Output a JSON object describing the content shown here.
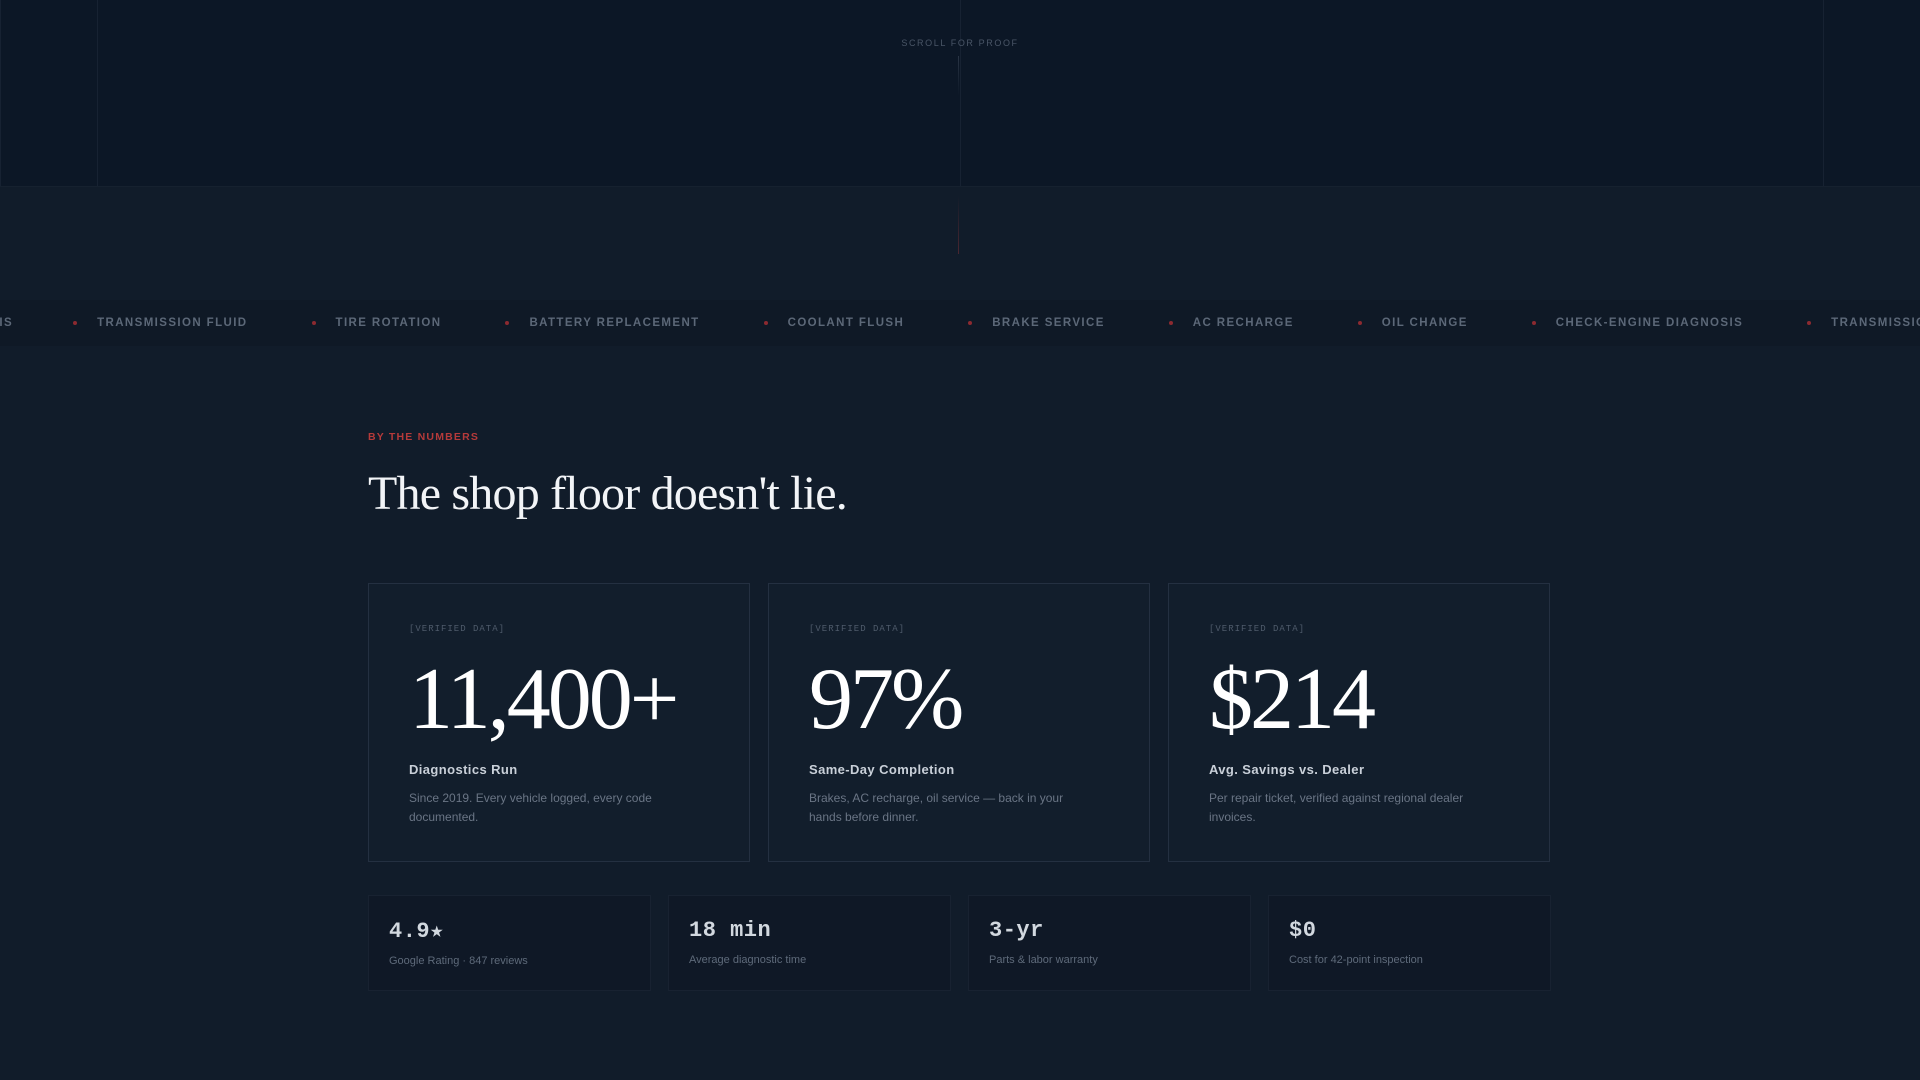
{
  "hero": {
    "scroll_label": "SCROLL FOR PROOF"
  },
  "ticker": {
    "items": [
      "OSIS",
      "TRANSMISSION FLUID",
      "TIRE ROTATION",
      "BATTERY REPLACEMENT",
      "COOLANT FLUSH",
      "BRAKE SERVICE",
      "AC RECHARGE",
      "OIL CHANGE",
      "CHECK-ENGINE DIAGNOSIS",
      "TRANSMISSION FLUID"
    ],
    "dot_color": "#8c2a30"
  },
  "stats": {
    "eyebrow": "BY THE NUMBERS",
    "headline": "The shop floor doesn't lie.",
    "accent_color": "#b63a3a",
    "cards": [
      {
        "tag": "[VERIFIED DATA]",
        "value": "11,400+",
        "title": "Diagnostics Run",
        "desc": "Since 2019. Every vehicle logged, every code documented."
      },
      {
        "tag": "[VERIFIED DATA]",
        "value": "97%",
        "title": "Same-Day Completion",
        "desc": "Brakes, AC recharge, oil service — back in your hands before dinner."
      },
      {
        "tag": "[VERIFIED DATA]",
        "value": "$214",
        "title": "Avg. Savings vs. Dealer",
        "desc": "Per repair ticket, verified against regional dealer invoices."
      }
    ],
    "mini": [
      {
        "value": "4.9★",
        "label": "Google Rating · 847 reviews"
      },
      {
        "value": "18 min",
        "label": "Average diagnostic time"
      },
      {
        "value": "3-yr",
        "label": "Parts & labor warranty"
      },
      {
        "value": "$0",
        "label": "Cost for 42-point inspection"
      }
    ]
  }
}
